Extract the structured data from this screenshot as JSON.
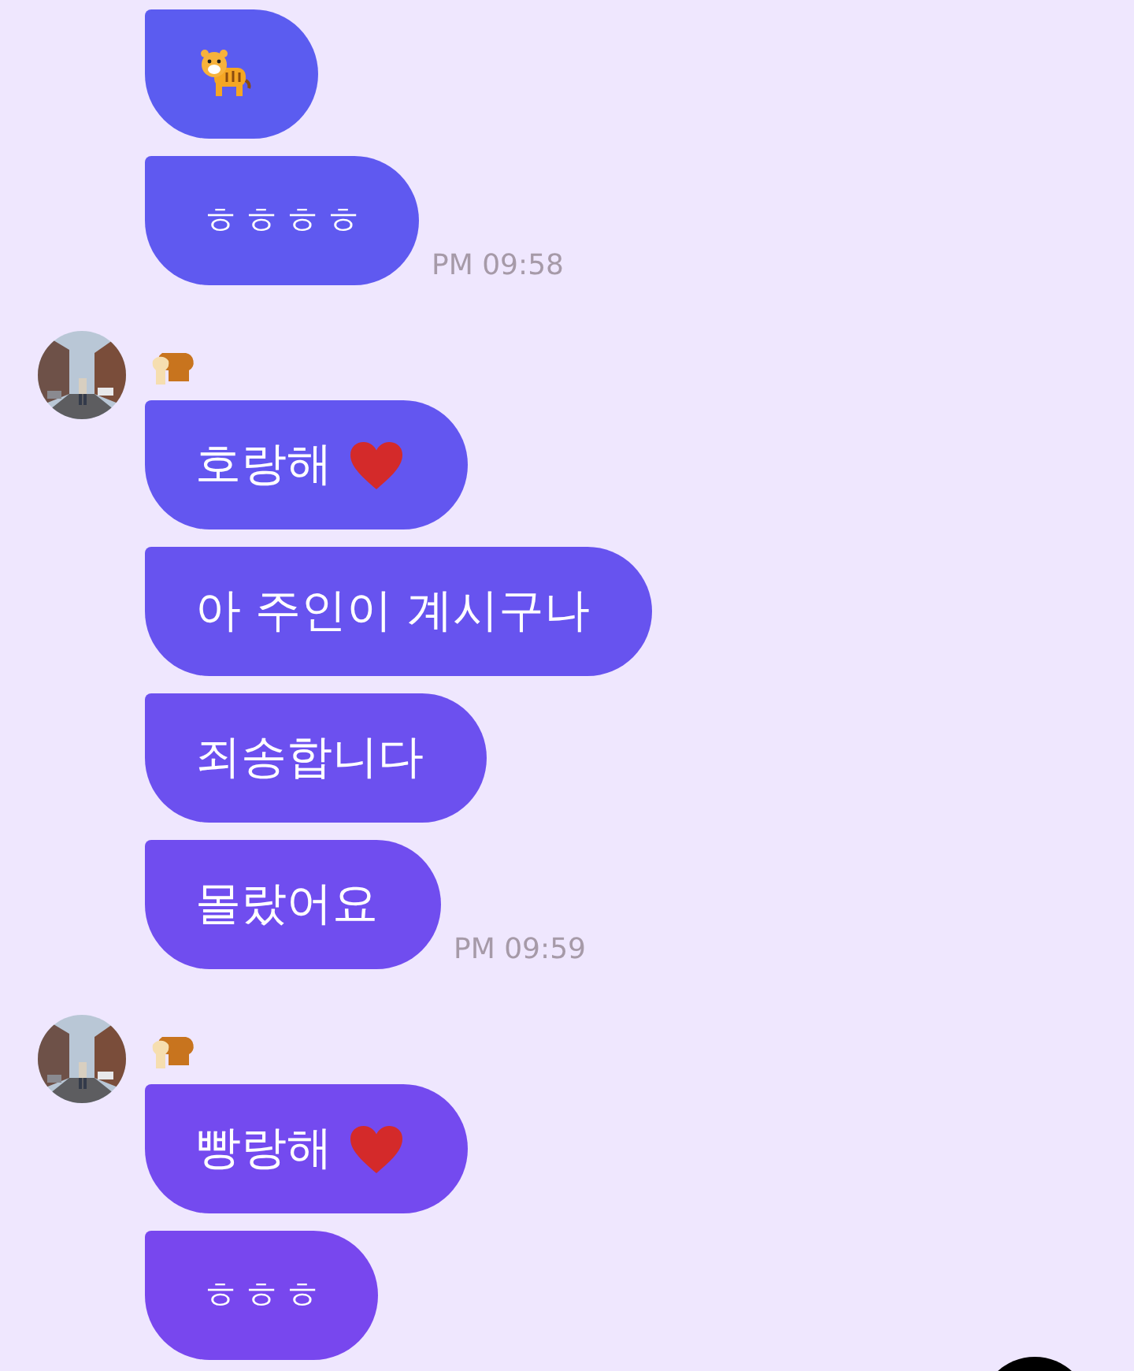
{
  "groups": [
    {
      "avatar": false,
      "sender_icon": false,
      "messages": [
        {
          "kind": "sticker"
        },
        {
          "kind": "text",
          "text": "ㅎㅎㅎㅎ",
          "heart": false
        }
      ],
      "time": "PM 09:58"
    },
    {
      "avatar": true,
      "sender_icon": true,
      "messages": [
        {
          "kind": "text",
          "text": "호랑해",
          "heart": true
        },
        {
          "kind": "text",
          "text": "아 주인이 계시구나",
          "heart": false
        },
        {
          "kind": "text",
          "text": "죄송합니다",
          "heart": false
        },
        {
          "kind": "text",
          "text": "몰랐어요",
          "heart": false
        }
      ],
      "time": "PM 09:59"
    },
    {
      "avatar": true,
      "sender_icon": true,
      "messages": [
        {
          "kind": "text",
          "text": "빵랑해",
          "heart": true
        },
        {
          "kind": "text",
          "text": "ㅎㅎㅎ",
          "heart": false
        }
      ]
    }
  ]
}
